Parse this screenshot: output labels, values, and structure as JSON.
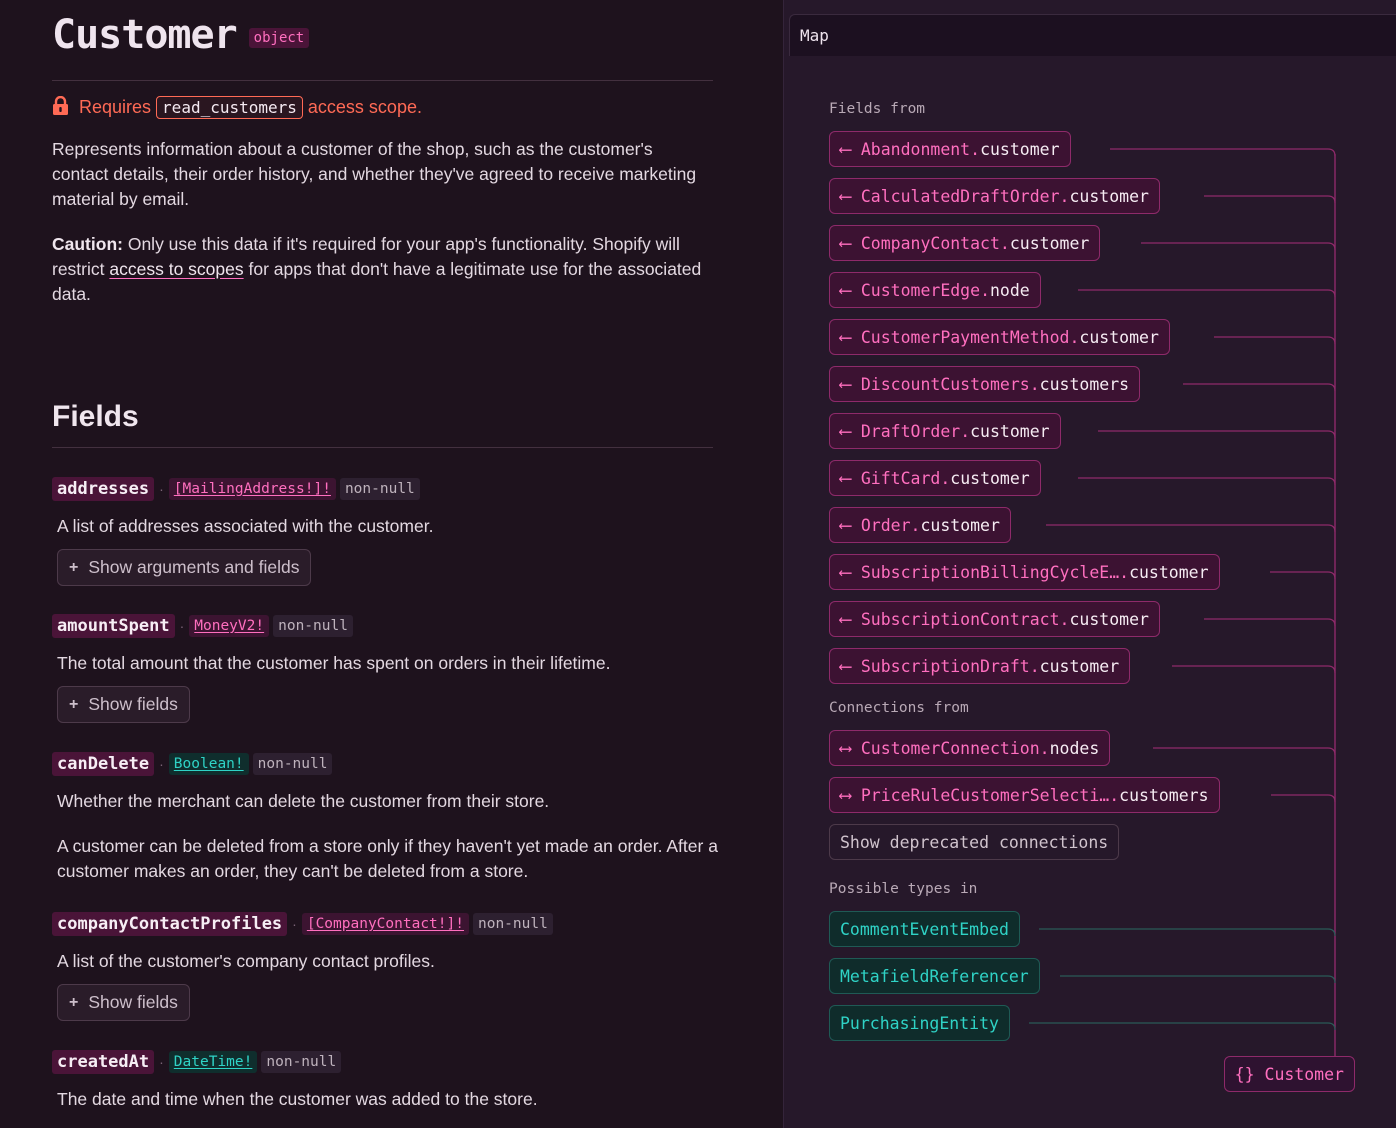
{
  "header": {
    "title": "Customer",
    "kind": "object"
  },
  "scope": {
    "prefix": "Requires",
    "code": "read_customers",
    "suffix": "access scope."
  },
  "description": "Represents information about a customer of the shop, such as the customer's contact details, their order history, and whether they've agreed to receive marketing material by email.",
  "caution": {
    "label": "Caution:",
    "text_before": " Only use this data if it's required for your app's functionality. Shopify will restrict ",
    "link": "access to scopes",
    "text_after": " for apps that don't have a legitimate use for the associated data."
  },
  "fields_section": {
    "title": "Fields",
    "items": [
      {
        "name": "addresses",
        "type": "[MailingAddress!]!",
        "nonnull": "non-null",
        "description": "A list of addresses associated with the customer.",
        "button": "Show arguments and fields"
      },
      {
        "name": "amountSpent",
        "type": "MoneyV2!",
        "nonnull": "non-null",
        "description": "The total amount that the customer has spent on orders in their lifetime.",
        "button": "Show fields"
      },
      {
        "name": "canDelete",
        "type": "Boolean!",
        "nonnull": "non-null",
        "description": "Whether the merchant can delete the customer from their store.",
        "description2": "A customer can be deleted from a store only if they haven't yet made an order. After a customer makes an order, they can't be deleted from a store."
      },
      {
        "name": "companyContactProfiles",
        "type": "[CompanyContact!]!",
        "nonnull": "non-null",
        "description": "A list of the customer's company contact profiles.",
        "button": "Show fields"
      },
      {
        "name": "createdAt",
        "type": "DateTime!",
        "nonnull": "non-null",
        "description": "The date and time when the customer was added to the store."
      }
    ]
  },
  "map": {
    "title": "Map",
    "fields_from_label": "Fields from",
    "fields_from": [
      {
        "type": "Abandonment",
        "field": "customer"
      },
      {
        "type": "CalculatedDraftOrder",
        "field": "customer"
      },
      {
        "type": "CompanyContact",
        "field": "customer"
      },
      {
        "type": "CustomerEdge",
        "field": "node"
      },
      {
        "type": "CustomerPaymentMethod",
        "field": "customer"
      },
      {
        "type": "DiscountCustomers",
        "field": "customers"
      },
      {
        "type": "DraftOrder",
        "field": "customer"
      },
      {
        "type": "GiftCard",
        "field": "customer"
      },
      {
        "type": "Order",
        "field": "customer"
      },
      {
        "type": "SubscriptionBillingCycleE… ",
        "field": "customer"
      },
      {
        "type": "SubscriptionContract",
        "field": "customer"
      },
      {
        "type": "SubscriptionDraft",
        "field": "customer"
      }
    ],
    "connections_from_label": "Connections from",
    "connections_from": [
      {
        "type": "CustomerConnection",
        "field": "nodes"
      },
      {
        "type": "PriceRuleCustomerSelecti… ",
        "field": "customers"
      }
    ],
    "deprecated_button": "Show deprecated connections",
    "possible_types_label": "Possible types in",
    "possible_types": [
      "CommentEventEmbed",
      "MetafieldReferencer",
      "PurchasingEntity"
    ],
    "target": "Customer",
    "target_icon": "{}",
    "field_arrow": "⟵",
    "connection_arrow": "⟷"
  },
  "colors": {
    "background": "#1e121d",
    "accent_pink": "#ff6fbf",
    "accent_teal": "#2fd3c6",
    "warning": "#ff6a55"
  }
}
